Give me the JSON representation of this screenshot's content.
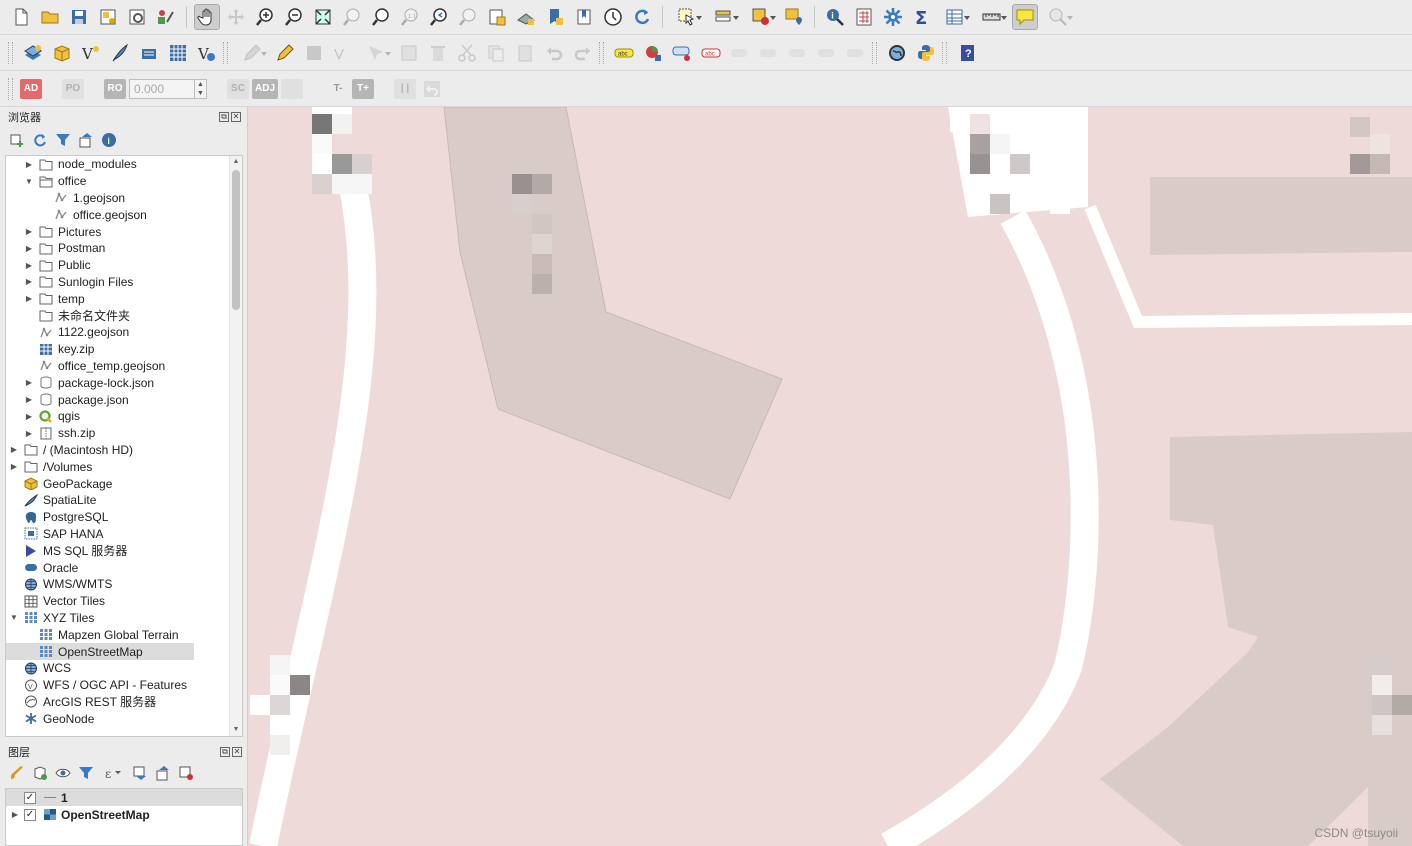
{
  "browser_panel": {
    "title": "浏览器",
    "items": [
      {
        "label": "node_modules",
        "icon": "folder-icon",
        "indent": 1,
        "expander": "collapsed"
      },
      {
        "label": "office",
        "icon": "folder-open-icon",
        "indent": 1,
        "expander": "expanded"
      },
      {
        "label": "1.geojson",
        "icon": "vector-file-icon",
        "indent": 2,
        "expander": "none"
      },
      {
        "label": "office.geojson",
        "icon": "vector-file-icon",
        "indent": 2,
        "expander": "none"
      },
      {
        "label": "Pictures",
        "icon": "folder-icon",
        "indent": 1,
        "expander": "collapsed"
      },
      {
        "label": "Postman",
        "icon": "folder-icon",
        "indent": 1,
        "expander": "collapsed"
      },
      {
        "label": "Public",
        "icon": "folder-icon",
        "indent": 1,
        "expander": "collapsed"
      },
      {
        "label": "Sunlogin Files",
        "icon": "folder-icon",
        "indent": 1,
        "expander": "collapsed"
      },
      {
        "label": "temp",
        "icon": "folder-icon",
        "indent": 1,
        "expander": "collapsed"
      },
      {
        "label": "未命名文件夹",
        "icon": "folder-icon",
        "indent": 1,
        "expander": "none"
      },
      {
        "label": "1122.geojson",
        "icon": "vector-file-icon",
        "indent": 1,
        "expander": "none"
      },
      {
        "label": "key.zip",
        "icon": "raster-zip-icon",
        "indent": 1,
        "expander": "none"
      },
      {
        "label": "office_temp.geojson",
        "icon": "vector-file-icon",
        "indent": 1,
        "expander": "none"
      },
      {
        "label": "package-lock.json",
        "icon": "database-icon",
        "indent": 1,
        "expander": "collapsed"
      },
      {
        "label": "package.json",
        "icon": "database-icon",
        "indent": 1,
        "expander": "collapsed"
      },
      {
        "label": "qgis",
        "icon": "qgis-icon",
        "indent": 1,
        "expander": "collapsed"
      },
      {
        "label": "ssh.zip",
        "icon": "zip-icon",
        "indent": 1,
        "expander": "collapsed"
      },
      {
        "label": "/ (Macintosh HD)",
        "icon": "folder-icon",
        "indent": 0,
        "expander": "collapsed"
      },
      {
        "label": "/Volumes",
        "icon": "folder-icon",
        "indent": 0,
        "expander": "collapsed"
      },
      {
        "label": "GeoPackage",
        "icon": "geopackage-icon",
        "indent": 0,
        "expander": "none"
      },
      {
        "label": "SpatiaLite",
        "icon": "spatialite-icon",
        "indent": 0,
        "expander": "none"
      },
      {
        "label": "PostgreSQL",
        "icon": "postgresql-icon",
        "indent": 0,
        "expander": "none"
      },
      {
        "label": "SAP HANA",
        "icon": "sap-hana-icon",
        "indent": 0,
        "expander": "none"
      },
      {
        "label": "MS SQL 服务器",
        "icon": "mssql-icon",
        "indent": 0,
        "expander": "none"
      },
      {
        "label": "Oracle",
        "icon": "oracle-icon",
        "indent": 0,
        "expander": "none"
      },
      {
        "label": "WMS/WMTS",
        "icon": "globe-icon",
        "indent": 0,
        "expander": "none"
      },
      {
        "label": "Vector Tiles",
        "icon": "vector-tiles-icon",
        "indent": 0,
        "expander": "none"
      },
      {
        "label": "XYZ Tiles",
        "icon": "xyz-tiles-icon",
        "indent": 0,
        "expander": "expanded"
      },
      {
        "label": "Mapzen Global Terrain",
        "icon": "xyz-tiles-icon",
        "indent": 1,
        "expander": "none"
      },
      {
        "label": "OpenStreetMap",
        "icon": "xyz-tiles-icon",
        "indent": 1,
        "expander": "none",
        "selected": true
      },
      {
        "label": "WCS",
        "icon": "globe-icon",
        "indent": 0,
        "expander": "none"
      },
      {
        "label": "WFS / OGC API - Features",
        "icon": "wfs-icon",
        "indent": 0,
        "expander": "none"
      },
      {
        "label": "ArcGIS REST 服务器",
        "icon": "arcgis-icon",
        "indent": 0,
        "expander": "none"
      },
      {
        "label": "GeoNode",
        "icon": "geonode-icon",
        "indent": 0,
        "expander": "none"
      }
    ]
  },
  "layers_panel": {
    "title": "图层",
    "layers": [
      {
        "label": "1",
        "checked": true,
        "icon": "line-layer-icon",
        "expander": "none",
        "selected": true
      },
      {
        "label": "OpenStreetMap",
        "checked": true,
        "icon": "raster-layer-icon",
        "expander": "collapsed",
        "selected": false
      }
    ]
  },
  "digitizing_toolbar": {
    "ad_label": "AD",
    "ro_label": "RO",
    "rd_label": "RO",
    "po_label": "PO",
    "value_input": "0.000",
    "sc_label": "SC",
    "adj_label": "ADJ",
    "t_minus_label": "T-",
    "t_plus_label": "T+"
  },
  "watermark": "CSDN @tsuyoii",
  "colors": {
    "map_background": "#efdada",
    "building_fill": "#d9ccc8",
    "road": "#ffffff",
    "selection": "#dcdcdc"
  }
}
